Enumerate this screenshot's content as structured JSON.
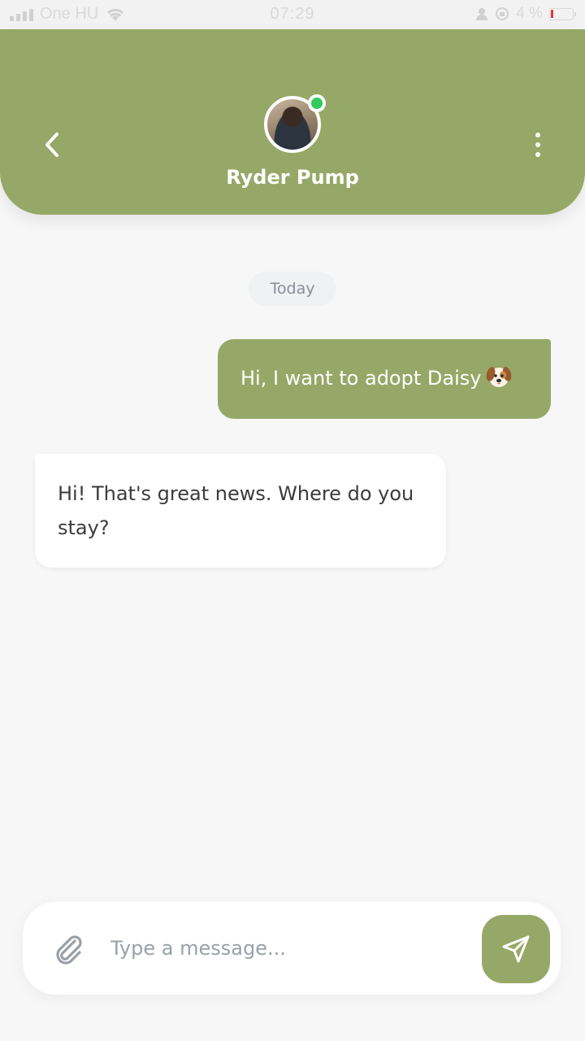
{
  "status_bar": {
    "carrier": "One HU",
    "time": "07:29",
    "battery_percent": "4 %"
  },
  "header": {
    "contact_name": "Ryder Pump",
    "online": true,
    "back_icon": "chevron-left-icon",
    "menu_icon": "more-vertical-icon"
  },
  "chat": {
    "date_label": "Today",
    "messages": [
      {
        "direction": "outgoing",
        "text": "Hi, I want to adopt Daisy",
        "emoji": "dog-face"
      },
      {
        "direction": "incoming",
        "text": "Hi! That's great news. Where do you stay?"
      }
    ]
  },
  "composer": {
    "placeholder": "Type a message...",
    "attach_icon": "paperclip-icon",
    "send_icon": "send-icon"
  },
  "colors": {
    "accent": "#96a867",
    "online": "#2ecc5a",
    "background": "#f7f7f7"
  }
}
